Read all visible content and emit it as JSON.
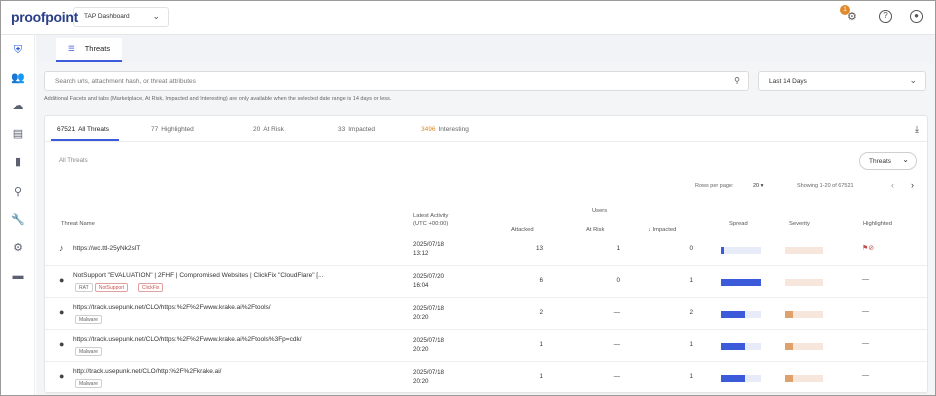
{
  "app": {
    "logo": "proofpoint",
    "selector_label": "TAP Dashboard",
    "badge_count": "1"
  },
  "header": {
    "tab_label": "Threats"
  },
  "search": {
    "placeholder": "Search urls, attachment hash, or threat attributes",
    "date_range": "Last 14 Days",
    "note": "Additional Facets and tabs (Marketplace, At Risk, Impacted and Interesting) are only available when the selected date range is 14 days or less."
  },
  "tabs": [
    {
      "count": "67521",
      "label": "All Threats"
    },
    {
      "count": "77",
      "label": "Highlighted"
    },
    {
      "count": "20",
      "label": "At Risk"
    },
    {
      "count": "33",
      "label": "Impacted"
    },
    {
      "count": "3496",
      "label": "Interesting"
    }
  ],
  "filter_label": "All Threats",
  "view_dropdown": "Threats",
  "pagination": {
    "rows_per_page_label": "Rows per page:",
    "rows_per_page": "20",
    "showing": "Showing 1-20 of 67521"
  },
  "columns": {
    "threat_name": "Threat Name",
    "latest_activity": "Latest Activity",
    "latest_activity_sub": "(UTC +00:00)",
    "attacked": "Attacked",
    "users_group": "Users",
    "at_risk": "At Risk",
    "impacted": "Impacted",
    "spread": "Spread",
    "severity": "Severity",
    "highlighted": "Highlighted"
  },
  "rows": [
    {
      "icon": "link-icon",
      "name": "https://wc.ttl-25yNk2slT",
      "tags": [],
      "date": "2025/07/18",
      "time": "13:12",
      "attacked": "13",
      "at_risk": "1",
      "impacted": "0",
      "spread": 0.08,
      "severity": 0.0,
      "highlighted": "flag"
    },
    {
      "icon": "bomb-icon",
      "name": "NotSupport \"EVALUATION\" | 2FHF | Compromised Websites | ClickFix \"CloudFlare\" [...",
      "tags": [
        {
          "text": "RAT",
          "red": false
        },
        {
          "text": "NotSupport",
          "red": true
        },
        {
          "text": "ClickFix",
          "red": true
        }
      ],
      "date": "2025/07/20",
      "time": "16:04",
      "attacked": "6",
      "at_risk": "0",
      "impacted": "1",
      "spread": 1.0,
      "severity": 0.0,
      "highlighted": "dash"
    },
    {
      "icon": "bomb-icon",
      "name": "https://track.usepunk.net/CLO/https:%2F%2Fwww.krake.ai%2Ftools/",
      "tags": [
        {
          "text": "Malware",
          "red": false
        }
      ],
      "date": "2025/07/18",
      "time": "20:20",
      "attacked": "2",
      "at_risk": "—",
      "impacted": "2",
      "spread": 0.6,
      "severity": 0.2,
      "highlighted": "dash"
    },
    {
      "icon": "bomb-icon",
      "name": "https://track.usepunk.net/CLO/https:%2F%2Fwww.krake.ai%2Ftools%3Fp=cdk/",
      "tags": [
        {
          "text": "Malware",
          "red": false
        }
      ],
      "date": "2025/07/18",
      "time": "20:20",
      "attacked": "1",
      "at_risk": "—",
      "impacted": "1",
      "spread": 0.6,
      "severity": 0.2,
      "highlighted": "dash"
    },
    {
      "icon": "bomb-icon",
      "name": "http://track.usepunk.net/CLO/http:%2F%2Fkrake.ai/",
      "tags": [
        {
          "text": "Malware",
          "red": false
        }
      ],
      "date": "2025/07/18",
      "time": "20:20",
      "attacked": "1",
      "at_risk": "—",
      "impacted": "1",
      "spread": 0.6,
      "severity": 0.2,
      "highlighted": "dash"
    }
  ]
}
